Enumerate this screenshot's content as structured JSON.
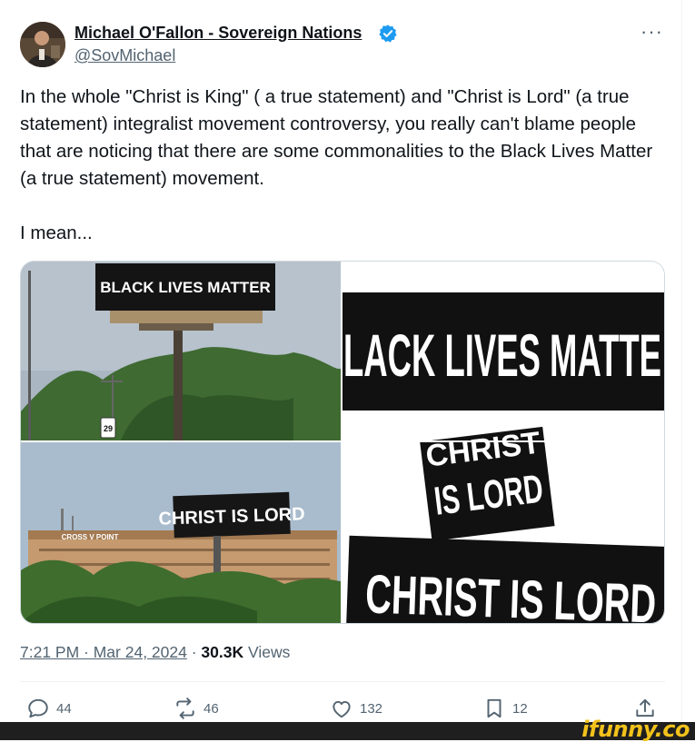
{
  "tweet": {
    "author_name": "Michael O'Fallon - Sovereign Nations",
    "author_handle": "@SovMichael",
    "text_paragraph_1": "In the whole \"Christ is King\" ( a true statement) and \"Christ is Lord\" (a true statement) integralist movement controversy, you really can't blame people that are noticing that there are some commonalities to the Black Lives Matter (a true statement) movement.",
    "text_paragraph_2": "I mean...",
    "timestamp": "7:21 PM · Mar 24, 2024",
    "separator": " · ",
    "views_count": "30.3K",
    "views_label": " Views",
    "more_icon": "···"
  },
  "media": {
    "billboard_1_text": "BLACK LIVES MATTER",
    "banner_1_text": "LACK LIVES MATTE",
    "billboard_2_text": "CHRIST IS LORD",
    "building_sign": "CROSS V POINT",
    "route_sign": "29",
    "card_top_text": "CHRIST",
    "card_mid_text": "IS LORD",
    "banner_2_text": "CHRIST IS LORD"
  },
  "actions": {
    "replies": "44",
    "reposts": "46",
    "likes": "132",
    "bookmarks": "12"
  },
  "watermark": "ifunny.co",
  "colors": {
    "verified": "#1d9bf0",
    "text_primary": "#0f1419",
    "text_secondary": "#536471",
    "watermark": "#f2c21b"
  },
  "icons": [
    "verified-badge-icon",
    "more-icon",
    "reply-icon",
    "repost-icon",
    "like-icon",
    "bookmark-icon",
    "share-icon"
  ]
}
